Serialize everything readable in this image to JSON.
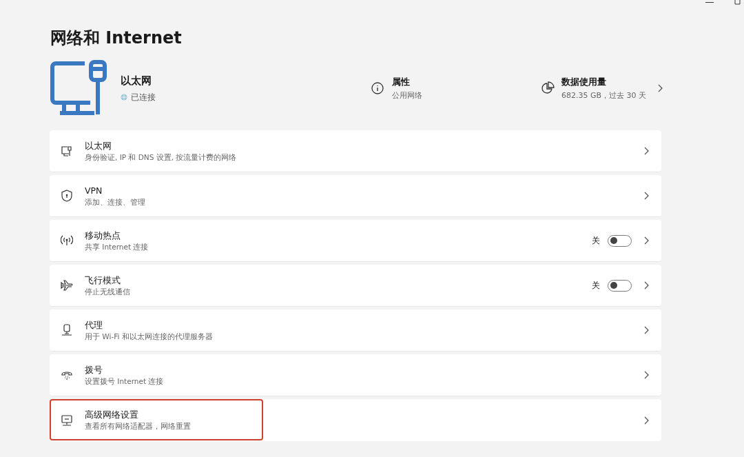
{
  "page_title": "网络和 Internet",
  "connection": {
    "name": "以太网",
    "status": "已连接"
  },
  "properties": {
    "title": "属性",
    "value": "公用网络"
  },
  "data_usage": {
    "title": "数据使用量",
    "value": "682.35 GB，过去 30 天"
  },
  "items": [
    {
      "kind": "link",
      "title": "以太网",
      "subtitle": "身份验证, IP 和 DNS 设置, 按流量计费的网络",
      "highlighted": false
    },
    {
      "kind": "link",
      "title": "VPN",
      "subtitle": "添加、连接、管理",
      "highlighted": false
    },
    {
      "kind": "toggle",
      "title": "移动热点",
      "subtitle": "共享 Internet 连接",
      "state_label": "关",
      "on": false,
      "highlighted": false
    },
    {
      "kind": "toggle",
      "title": "飞行模式",
      "subtitle": "停止无线通信",
      "state_label": "关",
      "on": false,
      "highlighted": false
    },
    {
      "kind": "link",
      "title": "代理",
      "subtitle": "用于 Wi-Fi 和以太网连接的代理服务器",
      "highlighted": false
    },
    {
      "kind": "link",
      "title": "拨号",
      "subtitle": "设置拨号 Internet 连接",
      "highlighted": false
    },
    {
      "kind": "link",
      "title": "高级网络设置",
      "subtitle": "查看所有网络适配器，网络重置",
      "highlighted": true
    }
  ]
}
